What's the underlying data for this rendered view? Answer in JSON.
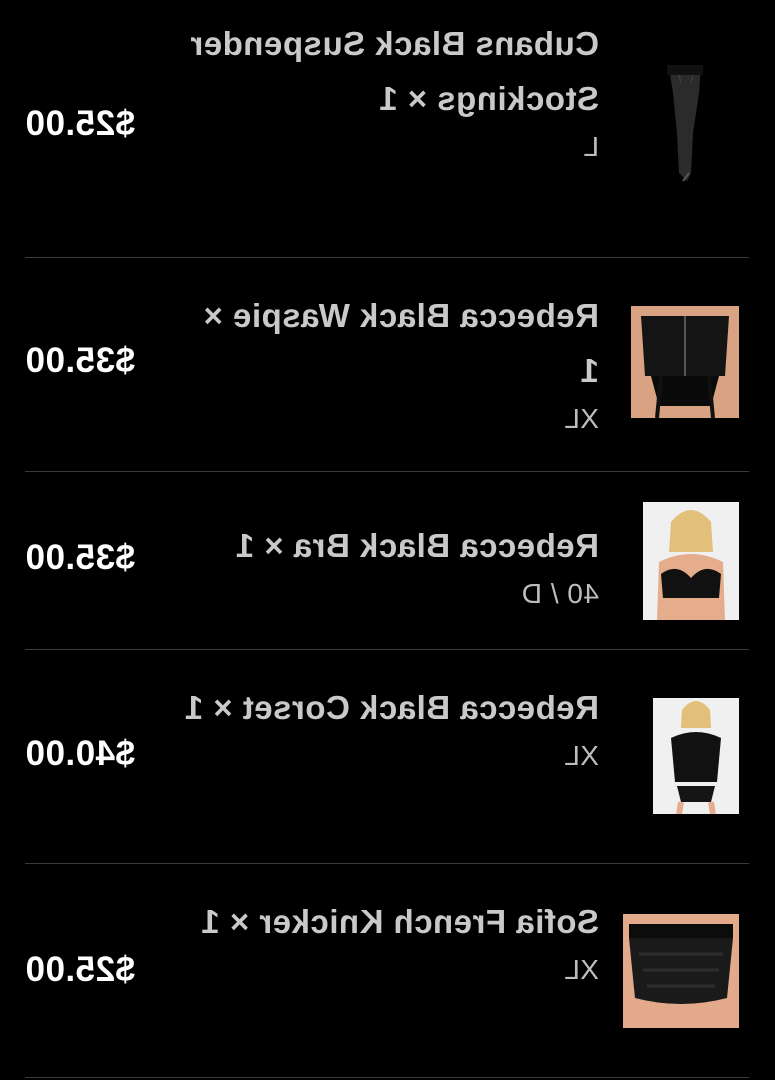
{
  "items": [
    {
      "name": "Cubans Black Suspender Stockings × 1",
      "variant": "L",
      "price": "$25.00",
      "thumb_icon": "stockings-product-image"
    },
    {
      "name": "Rebecca Black Waspie × 1",
      "variant": "XL",
      "price": "$35.00",
      "thumb_icon": "waspie-product-image"
    },
    {
      "name": "Rebecca Black Bra × 1",
      "variant": "40 / D",
      "price": "$35.00",
      "thumb_icon": "bra-product-image"
    },
    {
      "name": "Rebecca Black Corset × 1",
      "variant": "XL",
      "price": "$40.00",
      "thumb_icon": "corset-product-image"
    },
    {
      "name": "Sofia French Knicker × 1",
      "variant": "XL",
      "price": "$25.00",
      "thumb_icon": "knicker-product-image"
    }
  ],
  "colors": {
    "background": "#000000",
    "divider": "#3a3a3a",
    "name_text": "#c9c9c9",
    "price_text": "#ffffff"
  }
}
